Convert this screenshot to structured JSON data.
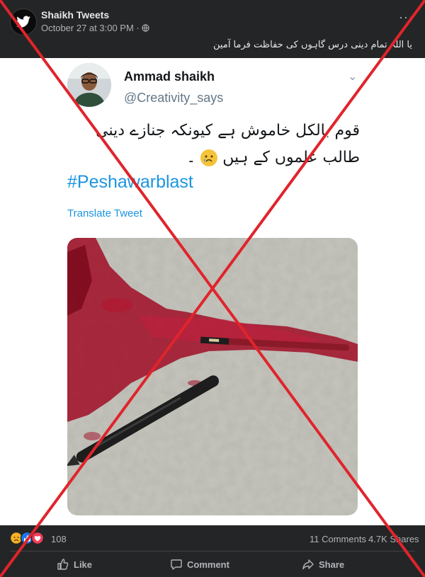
{
  "post": {
    "page_name": "Shaikh Tweets",
    "timestamp": "October 27 at 3:00 PM",
    "privacy_icon": "globe-icon",
    "more_icon": "more-dots-icon",
    "more_text": "···",
    "caption": "یا اللہ تمام دینی درس گاہوں کی حفاظت فرما آمین"
  },
  "tweet": {
    "author_name": "Ammad shaikh",
    "author_handle": "@Creativity_says",
    "chevron": "⌄",
    "urdu_line1": "قوم بالکل خاموش ہے کیونکہ جنازے دینی",
    "urdu_line2": "طالب علموں کے ہیں",
    "urdu_line2_end": "۔",
    "hashtag": "#Peshawarblast",
    "translate_label": "Translate Tweet"
  },
  "reactions": {
    "count": "108",
    "comments": "11 Comments",
    "shares": "4.7K Shares",
    "icons": [
      "sad-icon",
      "like-icon",
      "love-icon"
    ]
  },
  "actions": {
    "like": "Like",
    "comment": "Comment",
    "share": "Share"
  },
  "colors": {
    "fb_dark": "#242526",
    "twitter_blue": "#1b95e0",
    "cross_red": "#e0242b"
  }
}
